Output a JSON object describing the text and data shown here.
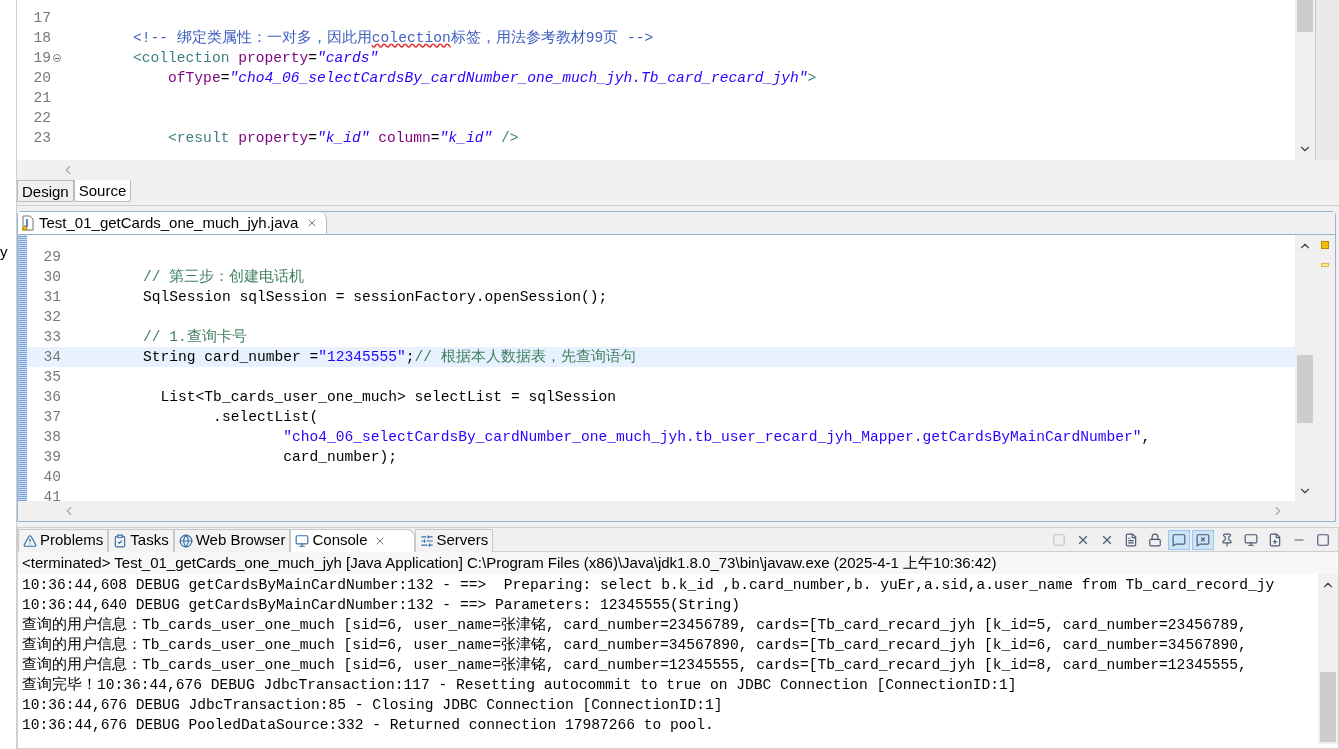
{
  "left_view": {
    "fragment": "y"
  },
  "xml_editor": {
    "lines": [
      {
        "number": "17",
        "foldable": false,
        "selected": false
      },
      {
        "number": "18",
        "foldable": false,
        "selected": false,
        "segments": [
          {
            "kind": "comment",
            "text": "        <!-- 绑定类属性：一对多，因此用"
          },
          {
            "kind": "misspelled",
            "text": "colection"
          },
          {
            "kind": "comment",
            "text": "标签，用法参考教材99页 -->"
          }
        ]
      },
      {
        "number": "19",
        "foldable": true,
        "selected": false,
        "segments": [
          {
            "kind": "tag",
            "text": "        <collection "
          },
          {
            "kind": "attr",
            "text": "property"
          },
          {
            "kind": "plain",
            "text": "="
          },
          {
            "kind": "value",
            "text": "\"cards\""
          }
        ]
      },
      {
        "number": "20",
        "foldable": false,
        "selected": false,
        "segments": [
          {
            "kind": "attr",
            "text": "            ofType"
          },
          {
            "kind": "plain",
            "text": "="
          },
          {
            "kind": "value",
            "text": "\"cho4_06_selectCardsBy_cardNumber_one_much_jyh.Tb_card_recard_jyh\""
          },
          {
            "kind": "tag",
            "text": ">"
          }
        ]
      },
      {
        "number": "21",
        "foldable": false,
        "selected": false
      },
      {
        "number": "22",
        "foldable": false,
        "selected": false
      },
      {
        "number": "23",
        "foldable": false,
        "selected": false,
        "segments": [
          {
            "kind": "tag",
            "text": "            <result "
          },
          {
            "kind": "attr",
            "text": "property"
          },
          {
            "kind": "plain",
            "text": "="
          },
          {
            "kind": "value",
            "text": "\"k_id\""
          },
          {
            "kind": "attr",
            "text": " column"
          },
          {
            "kind": "plain",
            "text": "="
          },
          {
            "kind": "value",
            "text": "\"k_id\""
          },
          {
            "kind": "tag",
            "text": " />"
          }
        ]
      }
    ],
    "tabs": [
      {
        "label": "Design",
        "selected": false
      },
      {
        "label": "Source",
        "selected": true
      }
    ]
  },
  "java_editor": {
    "tab": {
      "label": "Test_01_getCards_one_much_jyh.java"
    },
    "lines": [
      {
        "number": "29",
        "selected": false
      },
      {
        "number": "30",
        "selected": false,
        "segments": [
          {
            "kind": "comment",
            "text": "        // 第三步：创建电话机"
          }
        ]
      },
      {
        "number": "31",
        "selected": false,
        "segments": [
          {
            "kind": "plain",
            "text": "        SqlSession sqlSession = sessionFactory.openSession();"
          }
        ]
      },
      {
        "number": "32",
        "selected": false
      },
      {
        "number": "33",
        "selected": false,
        "segments": [
          {
            "kind": "comment",
            "text": "        // 1.查询卡号"
          }
        ]
      },
      {
        "number": "34",
        "selected": true,
        "segments": [
          {
            "kind": "plain",
            "text": "        String card_number ="
          },
          {
            "kind": "string",
            "text": "\"12345555\""
          },
          {
            "kind": "plain",
            "text": ";"
          },
          {
            "kind": "comment",
            "text": "// 根据本人数据表，先查询语句"
          }
        ]
      },
      {
        "number": "35",
        "selected": false
      },
      {
        "number": "36",
        "selected": false,
        "segments": [
          {
            "kind": "plain",
            "text": "          List<Tb_cards_user_one_much> selectList = sqlSession"
          }
        ]
      },
      {
        "number": "37",
        "selected": false,
        "segments": [
          {
            "kind": "plain",
            "text": "                .selectList("
          }
        ]
      },
      {
        "number": "38",
        "selected": false,
        "segments": [
          {
            "kind": "string",
            "text": "                        \"cho4_06_selectCardsBy_cardNumber_one_much_jyh.tb_user_recard_jyh_Mapper.getCardsByMainCardNumber\""
          },
          {
            "kind": "plain",
            "text": ","
          }
        ]
      },
      {
        "number": "39",
        "selected": false,
        "segments": [
          {
            "kind": "plain",
            "text": "                        card_number);"
          }
        ]
      },
      {
        "number": "40",
        "selected": false
      },
      {
        "number": "41",
        "selected": false
      }
    ]
  },
  "bottom_tabs": [
    {
      "label": "Problems",
      "kind": "problems",
      "selected": false
    },
    {
      "label": "Tasks",
      "kind": "tasks",
      "selected": false
    },
    {
      "label": "Web Browser",
      "kind": "browser",
      "selected": false
    },
    {
      "label": "Console",
      "kind": "console",
      "selected": true
    },
    {
      "label": "Servers",
      "kind": "servers",
      "selected": false
    }
  ],
  "console_toolbar": [
    {
      "kind": "terminate",
      "disabled": true,
      "pressed": false
    },
    {
      "kind": "remove",
      "disabled": false,
      "pressed": false
    },
    {
      "kind": "remove_all",
      "disabled": false,
      "pressed": false
    },
    {
      "kind": "clear",
      "disabled": false,
      "pressed": false
    },
    {
      "kind": "scroll_lock",
      "disabled": false,
      "pressed": false
    },
    {
      "kind": "show_on_output",
      "disabled": false,
      "pressed": true
    },
    {
      "kind": "show_on_error",
      "disabled": false,
      "pressed": true
    },
    {
      "kind": "pin",
      "disabled": false,
      "pressed": false
    },
    {
      "kind": "display",
      "disabled": false,
      "pressed": false
    },
    {
      "kind": "open",
      "disabled": false,
      "pressed": false
    },
    {
      "kind": "minimize",
      "disabled": false,
      "pressed": false
    },
    {
      "kind": "maximize",
      "disabled": false,
      "pressed": false
    }
  ],
  "console": {
    "header": "<terminated> Test_01_getCards_one_much_jyh [Java Application] C:\\Program Files (x86)\\Java\\jdk1.8.0_73\\bin\\javaw.exe (2025-4-1 上午10:36:42)",
    "lines": [
      "10:36:44,608 DEBUG getCardsByMainCardNumber:132 - ==>  Preparing: select b.k_id ,b.card_number,b. yuEr,a.sid,a.user_name from Tb_card_record_jy",
      "10:36:44,640 DEBUG getCardsByMainCardNumber:132 - ==> Parameters: 12345555(String)",
      "查询的用户信息：Tb_cards_user_one_much [sid=6, user_name=张津铭, card_number=23456789, cards=[Tb_card_recard_jyh [k_id=5, card_number=23456789,",
      "查询的用户信息：Tb_cards_user_one_much [sid=6, user_name=张津铭, card_number=34567890, cards=[Tb_card_recard_jyh [k_id=6, card_number=34567890,",
      "查询的用户信息：Tb_cards_user_one_much [sid=6, user_name=张津铭, card_number=12345555, cards=[Tb_card_recard_jyh [k_id=8, card_number=12345555,",
      "查询完毕！10:36:44,676 DEBUG JdbcTransaction:117 - Resetting autocommit to true on JDBC Connection [ConnectionID:1]",
      "10:36:44,676 DEBUG JdbcTransaction:85 - Closing JDBC Connection [ConnectionID:1]",
      "10:36:44,676 DEBUG PooledDataSource:332 - Returned connection 17987266 to pool."
    ]
  }
}
